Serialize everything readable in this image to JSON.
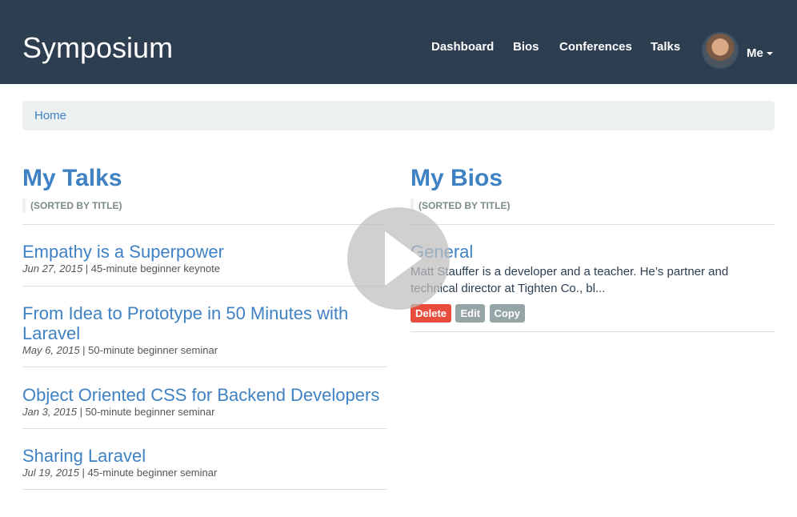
{
  "header": {
    "brand": "Symposium",
    "nav": {
      "dashboard": "Dashboard",
      "bios": "Bios",
      "conferences": "Conferences",
      "talks": "Talks"
    },
    "user_menu": "Me"
  },
  "breadcrumb": {
    "home": "Home"
  },
  "talks": {
    "title": "My Talks",
    "sort_note": "(Sorted by title)",
    "items": [
      {
        "title": "Empathy is a Superpower",
        "date": "Jun 27, 2015",
        "separator": " | ",
        "desc": "45-minute beginner keynote"
      },
      {
        "title": "From Idea to Prototype in 50 Minutes with Laravel",
        "date": "May 6, 2015",
        "separator": " | ",
        "desc": "50-minute beginner seminar"
      },
      {
        "title": "Object Oriented CSS for Backend Developers",
        "date": "Jan 3, 2015",
        "separator": " | ",
        "desc": "50-minute beginner seminar"
      },
      {
        "title": "Sharing Laravel",
        "date": "Jul 19, 2015",
        "separator": " | ",
        "desc": "45-minute beginner seminar"
      }
    ]
  },
  "bios": {
    "title": "My Bios",
    "sort_note": "(Sorted by title)",
    "items": [
      {
        "title": "General",
        "body": "Matt Stauffer is a developer and a teacher. He’s partner and technical director at Tighten Co., bl...",
        "actions": {
          "delete": "Delete",
          "edit": "Edit",
          "copy": "Copy"
        }
      }
    ]
  },
  "overlay": {
    "icon": "play-icon"
  },
  "colors": {
    "navbar": "#2c3e50",
    "link": "#3f82c4",
    "breadcrumb_bg": "#ecf0f1",
    "delete": "#e74c3c",
    "neutral_button": "#95a5a6"
  }
}
